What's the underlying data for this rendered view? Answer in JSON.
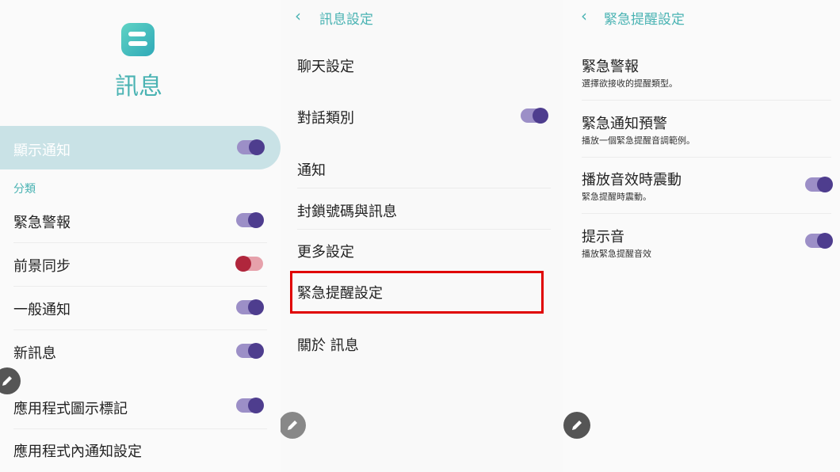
{
  "panel1": {
    "app_title": "訊息",
    "show_notifications_label": "顯示通知",
    "section_label": "分類",
    "items": [
      {
        "label": "緊急警報"
      },
      {
        "label": "前景同步"
      },
      {
        "label": "一般通知"
      },
      {
        "label": "新訊息"
      },
      {
        "label": "應用程式圖示標記"
      },
      {
        "label": "應用程式內通知設定"
      }
    ],
    "colors": {
      "accent": "#4ab3b3",
      "highlight": "#c9e2e6",
      "toggle_on": "#4e3d8e",
      "toggle_red": "#b0263c"
    }
  },
  "panel2": {
    "header": "訊息設定",
    "items": [
      {
        "label": "聊天設定"
      },
      {
        "label": "對話類別"
      },
      {
        "label": "通知"
      },
      {
        "label": "封鎖號碼與訊息"
      },
      {
        "label": "更多設定"
      },
      {
        "label": "緊急提醒設定"
      },
      {
        "label": "關於 訊息"
      }
    ],
    "highlight_color": "#e00000"
  },
  "panel3": {
    "header": "緊急提醒設定",
    "items": [
      {
        "label": "緊急警報",
        "desc": "選擇欲接收的提醒類型。"
      },
      {
        "label": "緊急通知預警",
        "desc": "播放一個緊急提醒音調範例。"
      },
      {
        "label": "播放音效時震動",
        "desc": "緊急提醒時震動。"
      },
      {
        "label": "提示音",
        "desc": "播放緊急提醒音效"
      }
    ]
  }
}
